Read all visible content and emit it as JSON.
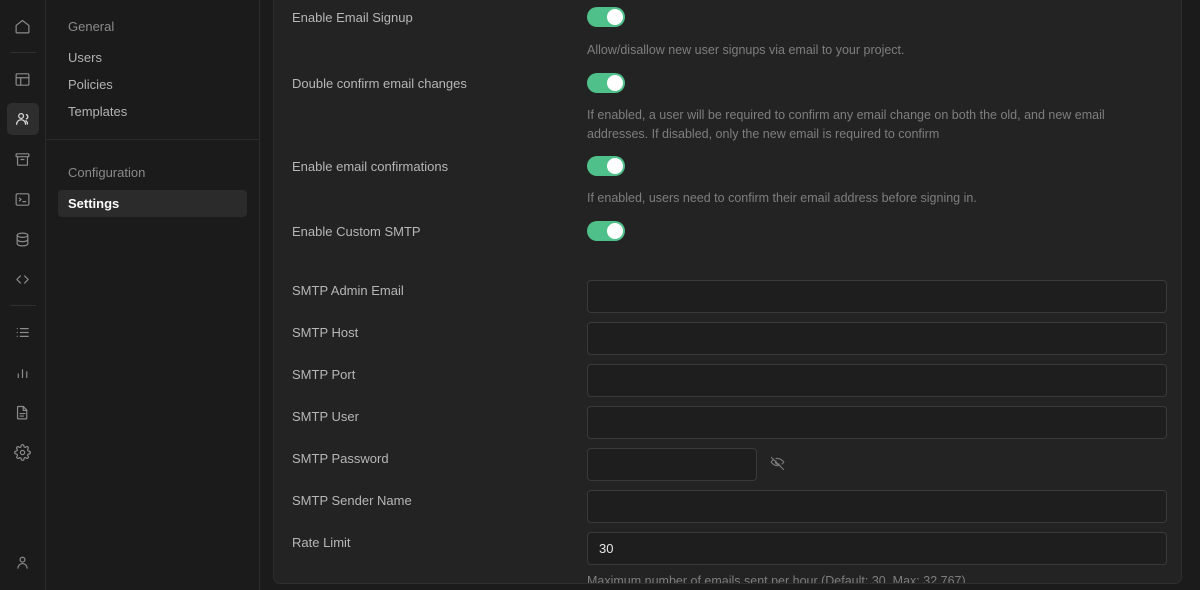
{
  "rail": {
    "items": [
      {
        "icon": "home-icon",
        "name": "rail-item-home",
        "active": false
      },
      {
        "icon": "table-icon",
        "name": "rail-item-table-editor",
        "active": false
      },
      {
        "icon": "users-icon",
        "name": "rail-item-authentication",
        "active": true
      },
      {
        "icon": "archive-icon",
        "name": "rail-item-storage",
        "active": false
      },
      {
        "icon": "terminal-icon",
        "name": "rail-item-sql-editor",
        "active": false
      },
      {
        "icon": "database-icon",
        "name": "rail-item-database",
        "active": false
      },
      {
        "icon": "code-icon",
        "name": "rail-item-api",
        "active": false
      },
      {
        "icon": "list-icon",
        "name": "rail-item-logs",
        "active": false
      },
      {
        "icon": "chart-bar-icon",
        "name": "rail-item-reports",
        "active": false
      },
      {
        "icon": "document-icon",
        "name": "rail-item-docs",
        "active": false
      },
      {
        "icon": "gear-icon",
        "name": "rail-item-settings",
        "active": false
      }
    ],
    "account_icon": "user-icon"
  },
  "sidebar": {
    "general": {
      "heading": "General",
      "items": [
        {
          "label": "Users",
          "active": false
        },
        {
          "label": "Policies",
          "active": false
        },
        {
          "label": "Templates",
          "active": false
        }
      ]
    },
    "configuration": {
      "heading": "Configuration",
      "items": [
        {
          "label": "Settings",
          "active": true
        }
      ]
    }
  },
  "settings": {
    "toggles": [
      {
        "label": "Enable Email Signup",
        "enabled": true,
        "description": "Allow/disallow new user signups via email to your project."
      },
      {
        "label": "Double confirm email changes",
        "enabled": true,
        "description": "If enabled, a user will be required to confirm any email change on both the old, and new email addresses. If disabled, only the new email is required to confirm"
      },
      {
        "label": "Enable email confirmations",
        "enabled": true,
        "description": "If enabled, users need to confirm their email address before signing in."
      },
      {
        "label": "Enable Custom SMTP",
        "enabled": true,
        "description": ""
      }
    ],
    "fields": [
      {
        "label": "SMTP Admin Email",
        "value": "",
        "placeholder": "",
        "type": "text"
      },
      {
        "label": "SMTP Host",
        "value": "",
        "placeholder": "",
        "type": "text"
      },
      {
        "label": "SMTP Port",
        "value": "",
        "placeholder": "",
        "type": "text"
      },
      {
        "label": "SMTP User",
        "value": "",
        "placeholder": "",
        "type": "text"
      },
      {
        "label": "SMTP Password",
        "value": "",
        "placeholder": "",
        "type": "password"
      },
      {
        "label": "SMTP Sender Name",
        "value": "",
        "placeholder": "",
        "type": "text"
      }
    ],
    "rate_limit": {
      "label": "Rate Limit",
      "value": "30",
      "helper": "Maximum number of emails sent per hour (Default: 30, Max: 32,767)"
    },
    "password_visibility_icon": "eye-off-icon"
  },
  "colors": {
    "toggle_on": "#4fc08a",
    "panel_bg": "#232323",
    "app_bg": "#1b1b1b",
    "input_bg": "#1e1e1e",
    "active_text": "#fbfbfb"
  }
}
